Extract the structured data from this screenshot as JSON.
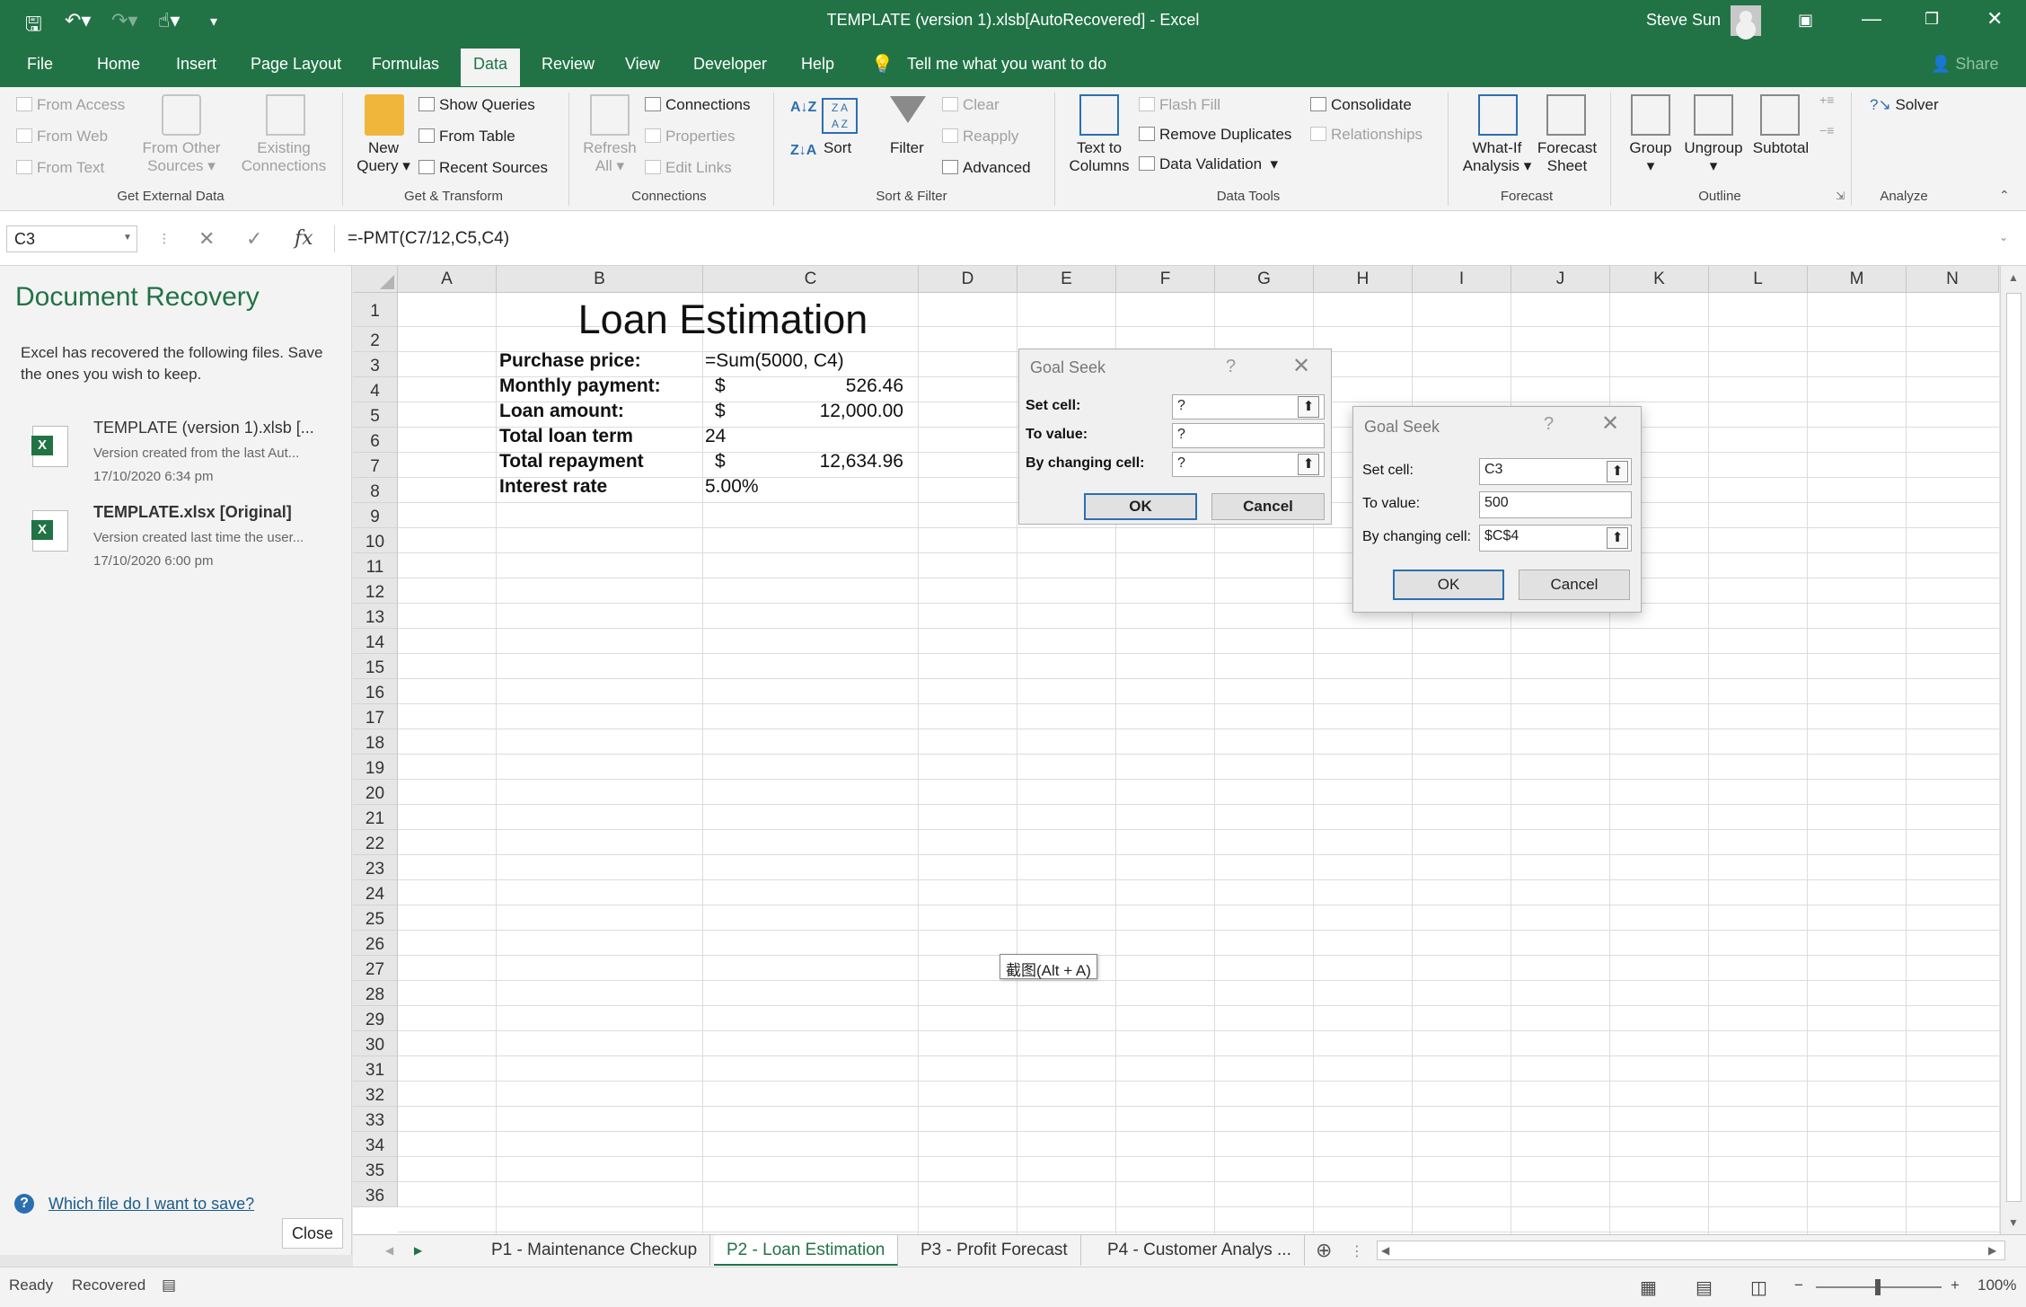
{
  "window": {
    "title": "TEMPLATE (version 1).xlsb[AutoRecovered]  -  Excel",
    "user": "Steve Sun"
  },
  "ribbon_tabs": [
    "File",
    "Home",
    "Insert",
    "Page Layout",
    "Formulas",
    "Data",
    "Review",
    "View",
    "Developer",
    "Help"
  ],
  "active_tab": "Data",
  "tell_me": "Tell me what you want to do",
  "share": "Share",
  "ribbon": {
    "get_external": {
      "from_access": "From Access",
      "from_web": "From Web",
      "from_text": "From Text",
      "from_other_1": "From Other",
      "from_other_2": "Sources",
      "existing_1": "Existing",
      "existing_2": "Connections",
      "label": "Get External Data"
    },
    "get_transform": {
      "new_query_1": "New",
      "new_query_2": "Query",
      "show_queries": "Show Queries",
      "from_table": "From Table",
      "recent_sources": "Recent Sources",
      "label": "Get & Transform"
    },
    "connections": {
      "refresh_1": "Refresh",
      "refresh_2": "All",
      "connections": "Connections",
      "properties": "Properties",
      "edit_links": "Edit Links",
      "label": "Connections"
    },
    "sort_filter": {
      "sort": "Sort",
      "filter": "Filter",
      "clear": "Clear",
      "reapply": "Reapply",
      "advanced": "Advanced",
      "label": "Sort & Filter"
    },
    "data_tools": {
      "text_to_1": "Text to",
      "text_to_2": "Columns",
      "flash_fill": "Flash Fill",
      "remove_duplicates": "Remove Duplicates",
      "data_validation": "Data Validation",
      "consolidate": "Consolidate",
      "relationships": "Relationships",
      "label": "Data Tools"
    },
    "forecast": {
      "whatif_1": "What-If",
      "whatif_2": "Analysis",
      "forecast_1": "Forecast",
      "forecast_2": "Sheet",
      "label": "Forecast"
    },
    "outline": {
      "group": "Group",
      "ungroup": "Ungroup",
      "subtotal": "Subtotal",
      "label": "Outline"
    },
    "analyze": {
      "solver": "Solver",
      "label": "Analyze"
    }
  },
  "formula_bar": {
    "name_box": "C3",
    "formula": "=-PMT(C7/12,C5,C4)"
  },
  "recovery": {
    "title": "Document Recovery",
    "description": "Excel has recovered the following files.  Save the ones you wish to keep.",
    "files": [
      {
        "name": "TEMPLATE (version 1).xlsb  [...",
        "desc": "Version created from the last Aut...",
        "time": "17/10/2020 6:34 pm"
      },
      {
        "name": "TEMPLATE.xlsx  [Original]",
        "desc": "Version created last time the user...",
        "time": "17/10/2020 6:00 pm"
      }
    ],
    "help_link": "Which file do I want to save?",
    "close": "Close"
  },
  "columns": [
    "A",
    "B",
    "C",
    "D",
    "E",
    "F",
    "G",
    "H",
    "I",
    "J",
    "K",
    "L",
    "M",
    "N"
  ],
  "rows": [
    "1",
    "2",
    "3",
    "4",
    "5",
    "6",
    "7",
    "8",
    "9",
    "10",
    "11",
    "12",
    "13",
    "14",
    "15",
    "16",
    "17",
    "18",
    "19",
    "20",
    "21",
    "22",
    "23",
    "24",
    "25",
    "26",
    "27",
    "28",
    "29",
    "30",
    "31",
    "32",
    "33",
    "34",
    "35",
    "36"
  ],
  "sheet": {
    "title": "Loan Estimation",
    "labels": [
      "Purchase price:",
      "Monthly  payment:",
      "Loan amount:",
      "Total loan term",
      "Total repayment",
      "Interest rate"
    ],
    "c2": "=Sum(5000, C4)",
    "c3_cur": "$",
    "c3": "526.46",
    "c4_cur": "$",
    "c4": "12,000.00",
    "c5": "24",
    "c6_cur": "$",
    "c6": "12,634.96",
    "c7": "5.00%"
  },
  "goal_seek_1": {
    "title": "Goal Seek",
    "help": "?",
    "set_cell_label": "Set cell:",
    "to_value_label": "To value:",
    "changing_label": "By changing cell:",
    "set_cell": "?",
    "to_value": "?",
    "changing": "?",
    "ok": "OK",
    "cancel": "Cancel"
  },
  "goal_seek_2": {
    "title": "Goal Seek",
    "help": "?",
    "set_cell_label": "Set cell:",
    "to_value_label": "To value:",
    "changing_label": "By changing cell:",
    "set_cell": "C3",
    "to_value": "500",
    "changing": "$C$4",
    "ok": "OK",
    "cancel": "Cancel"
  },
  "tooltip": "截图(Alt + A)",
  "sheet_tabs": [
    "P1 - Maintenance Checkup",
    "P2 - Loan Estimation",
    "P3 - Profit Forecast",
    "P4 - Customer Analys ..."
  ],
  "active_sheet": "P2 - Loan Estimation",
  "status": {
    "ready": "Ready",
    "recovered": "Recovered",
    "zoom": "100%"
  },
  "colors": {
    "excel_green": "#217346",
    "link_blue": "#1a5c8a",
    "dialog_default_border": "#2b6fb0"
  }
}
